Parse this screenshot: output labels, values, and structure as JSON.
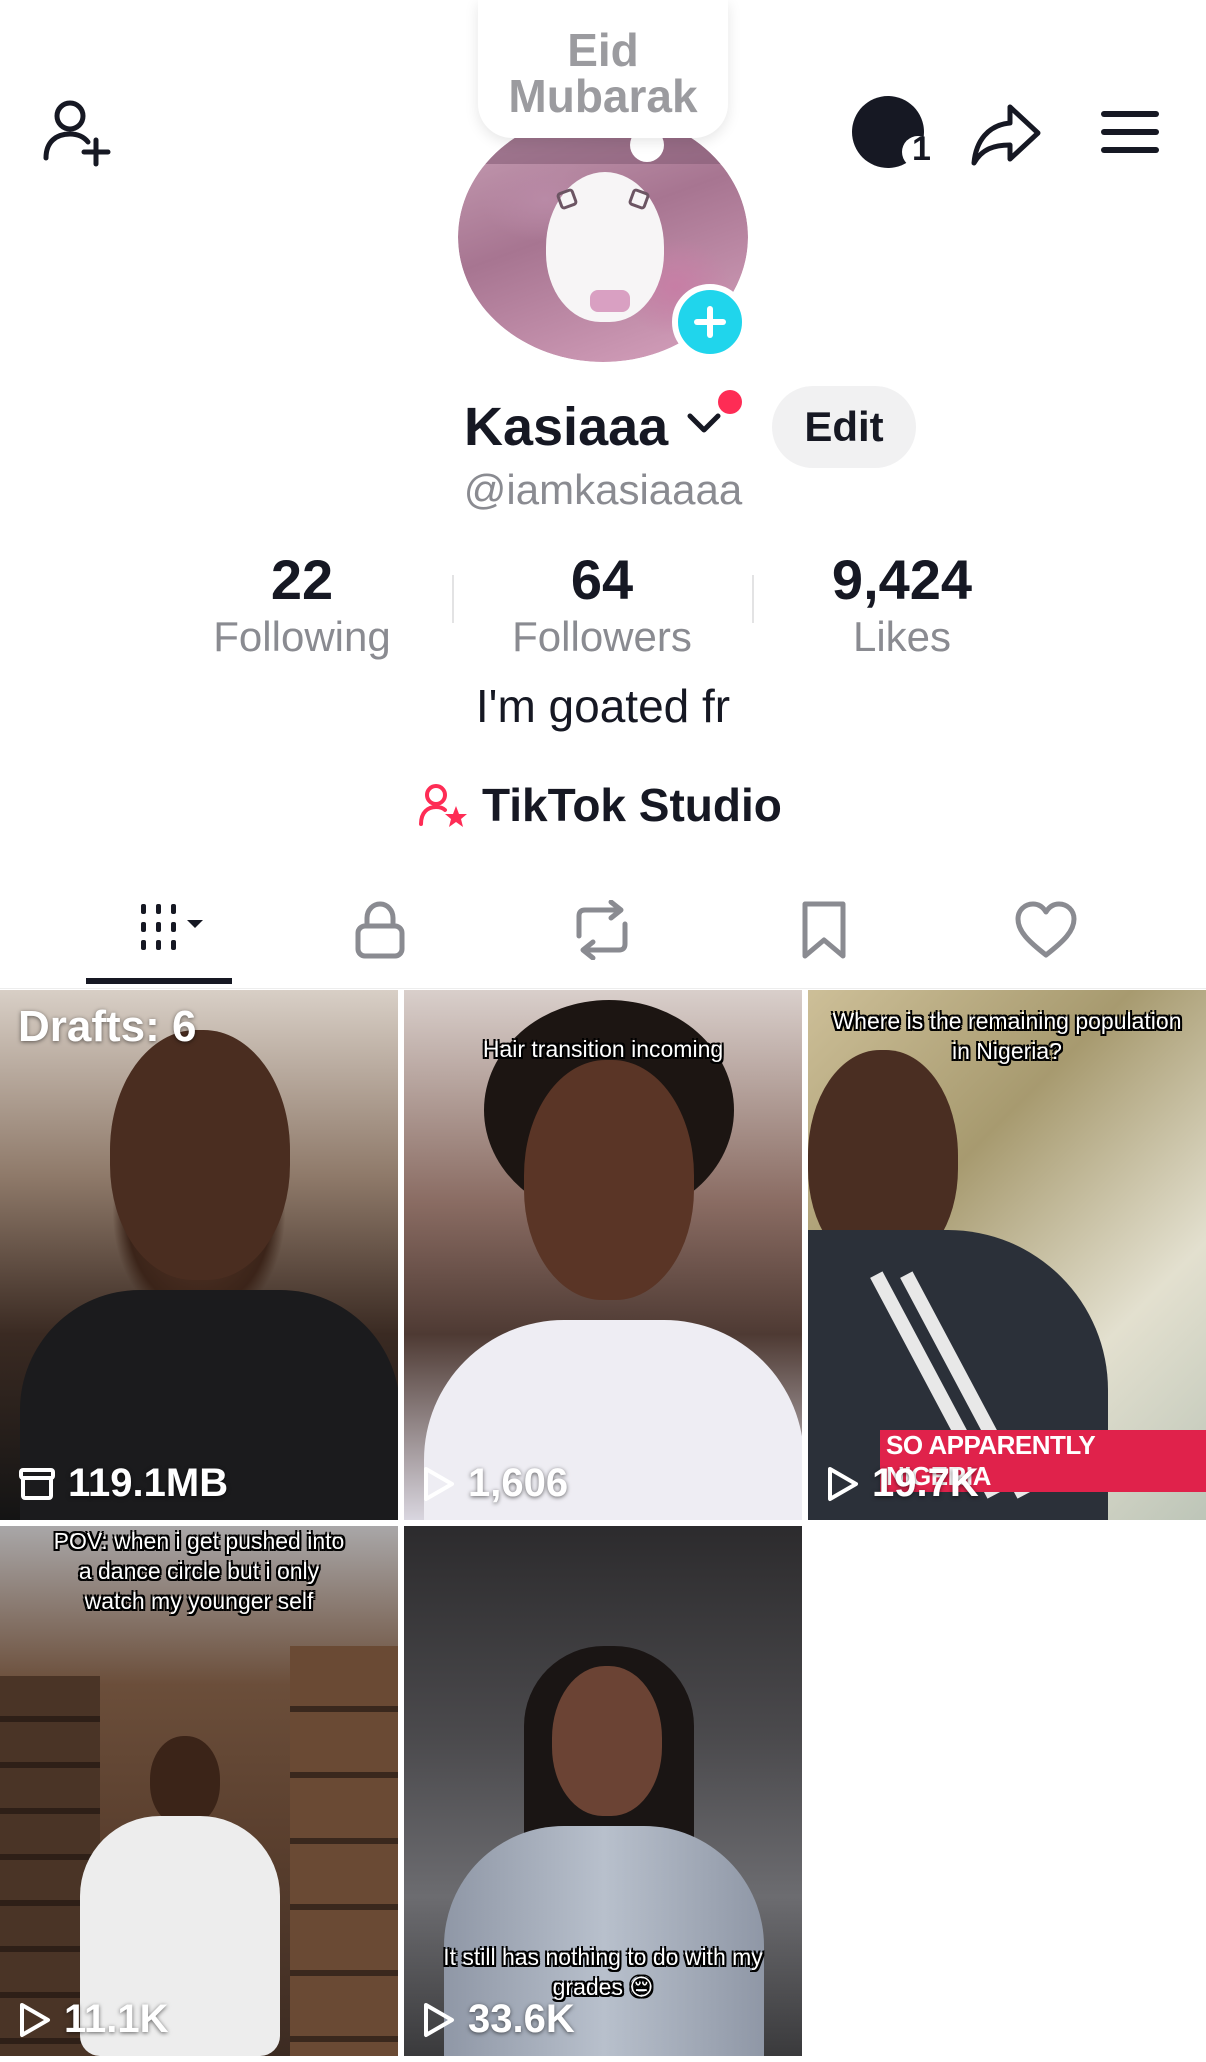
{
  "header": {
    "add_friend_icon": "person-add-icon",
    "profile_view_icon": "profile-views-icon",
    "profile_view_count": "1",
    "share_icon": "share-arrow-icon",
    "menu_icon": "hamburger-menu-icon"
  },
  "note": {
    "text": "Eid Mubarak"
  },
  "profile": {
    "name": "Kasiaaa",
    "handle": "@iamkasiaaaa",
    "edit_label": "Edit",
    "bio": "I'm goated fr",
    "studio_label": "TikTok Studio"
  },
  "stats": [
    {
      "value": "22",
      "label": "Following"
    },
    {
      "value": "64",
      "label": "Followers"
    },
    {
      "value": "9,424",
      "label": "Likes"
    }
  ],
  "tabs": [
    {
      "name": "videos",
      "icon": "grid-bars-icon",
      "active": true
    },
    {
      "name": "private",
      "icon": "lock-icon"
    },
    {
      "name": "reposts",
      "icon": "repost-icon"
    },
    {
      "name": "favorites",
      "icon": "bookmark-icon"
    },
    {
      "name": "liked",
      "icon": "heart-icon"
    }
  ],
  "videos": [
    {
      "type": "drafts",
      "label": "Drafts: 6",
      "size": "119.1MB"
    },
    {
      "caption": "Hair transition incoming",
      "views": "1,606"
    },
    {
      "caption": "Where is the remaining population in Nigeria?",
      "overlay": "SO APPARENTLY NIGERIA",
      "views": "19.7K"
    },
    {
      "caption": "POV: when i get pushed into a dance circle but i only watch my younger self",
      "views": "11.1K"
    },
    {
      "caption": "It still has nothing to do with my grades 😔",
      "views": "33.6K"
    }
  ],
  "colors": {
    "accent_pink": "#fe2c55",
    "accent_cyan": "#20d5ec",
    "text_primary": "#161823",
    "text_secondary": "#8a8b91"
  }
}
